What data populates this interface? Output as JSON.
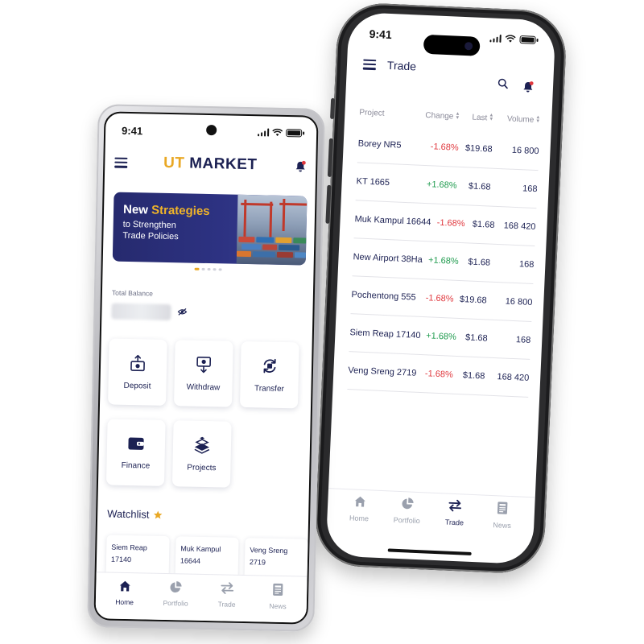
{
  "colors": {
    "navy": "#1c2153",
    "gold": "#e9a825",
    "negative": "#e0383e",
    "positive": "#1f9b4e"
  },
  "trade_screen": {
    "status_time": "9:41",
    "title": "Trade",
    "columns": {
      "project": "Project",
      "change": "Change",
      "last": "Last",
      "volume": "Volume"
    },
    "rows": [
      {
        "project": "Borey NR5",
        "change": "-1.68%",
        "direction": "down",
        "last": "$19.68",
        "volume": "16 800"
      },
      {
        "project": "KT 1665",
        "change": "+1.68%",
        "direction": "up",
        "last": "$1.68",
        "volume": "168"
      },
      {
        "project": "Muk Kampul 16644",
        "change": "-1.68%",
        "direction": "down",
        "last": "$1.68",
        "volume": "168 420"
      },
      {
        "project": "New Airport 38Ha",
        "change": "+1.68%",
        "direction": "up",
        "last": "$1.68",
        "volume": "168"
      },
      {
        "project": "Pochentong 555",
        "change": "-1.68%",
        "direction": "down",
        "last": "$19.68",
        "volume": "16 800"
      },
      {
        "project": "Siem Reap 17140",
        "change": "+1.68%",
        "direction": "up",
        "last": "$1.68",
        "volume": "168"
      },
      {
        "project": "Veng Sreng 2719",
        "change": "-1.68%",
        "direction": "down",
        "last": "$1.68",
        "volume": "168 420"
      }
    ],
    "nav": [
      {
        "label": "Home",
        "icon": "home-icon",
        "active": false
      },
      {
        "label": "Portfolio",
        "icon": "pie-chart-icon",
        "active": false
      },
      {
        "label": "Trade",
        "icon": "swap-arrows-icon",
        "active": true
      },
      {
        "label": "News",
        "icon": "newspaper-icon",
        "active": false
      }
    ]
  },
  "home_screen": {
    "status_time": "9:41",
    "logo": {
      "ut": "UT",
      "market": "MARKET"
    },
    "banner": {
      "line1_a": "New",
      "line1_b": "Strategies",
      "line2": "to Strengthen",
      "line3": "Trade Policies"
    },
    "balance_label": "Total Balance",
    "actions": [
      {
        "label": "Deposit",
        "icon": "deposit-icon"
      },
      {
        "label": "Withdraw",
        "icon": "withdraw-icon"
      },
      {
        "label": "Transfer",
        "icon": "transfer-icon"
      },
      {
        "label": "Finance",
        "icon": "wallet-icon"
      },
      {
        "label": "Projects",
        "icon": "layers-icon"
      }
    ],
    "watchlist_title": "Watchlist",
    "watchlist": [
      {
        "line1": "Siem Reap",
        "line2": "17140"
      },
      {
        "line1": "Muk Kampul",
        "line2": "16644"
      },
      {
        "line1": "Veng Sreng 2719",
        "line2": ""
      }
    ],
    "nav": [
      {
        "label": "Home",
        "icon": "home-icon",
        "active": true
      },
      {
        "label": "Portfolio",
        "icon": "pie-chart-icon",
        "active": false
      },
      {
        "label": "Trade",
        "icon": "swap-arrows-icon",
        "active": false
      },
      {
        "label": "News",
        "icon": "newspaper-icon",
        "active": false
      }
    ]
  }
}
